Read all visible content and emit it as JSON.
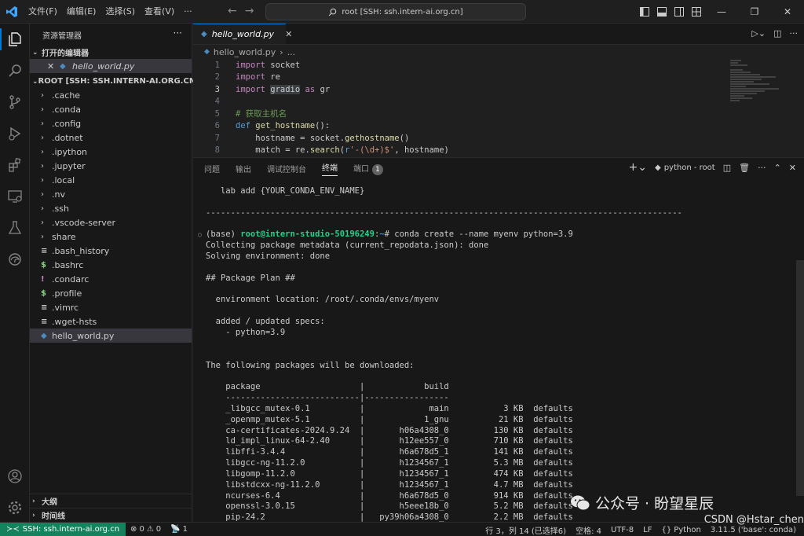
{
  "titlebar": {
    "menu": [
      "文件(F)",
      "编辑(E)",
      "选择(S)",
      "查看(V)",
      "···"
    ],
    "search_text": "root [SSH: ssh.intern-ai.org.cn]"
  },
  "sidebar": {
    "title": "资源管理器",
    "open_editors_label": "打开的编辑器",
    "open_editor_file": "hello_world.py",
    "root_label": "ROOT [SSH: SSH.INTERN-AI.ORG.CN]",
    "folders": [
      ".cache",
      ".conda",
      ".config",
      ".dotnet",
      ".ipython",
      ".jupyter",
      ".local",
      ".nv",
      ".ssh",
      ".vscode-server",
      "share"
    ],
    "files": [
      {
        "name": ".bash_history",
        "icon": "≡",
        "color": "#cccccc"
      },
      {
        "name": ".bashrc",
        "icon": "$",
        "color": "#89d185"
      },
      {
        "name": ".condarc",
        "icon": "!",
        "color": "#c586c0"
      },
      {
        "name": ".profile",
        "icon": "$",
        "color": "#89d185"
      },
      {
        "name": ".vimrc",
        "icon": "≡",
        "color": "#cccccc"
      },
      {
        "name": ".wget-hsts",
        "icon": "≡",
        "color": "#cccccc"
      },
      {
        "name": "hello_world.py",
        "icon": "py",
        "color": "#4b8bbe"
      }
    ],
    "outline_label": "大纲",
    "timeline_label": "时间线"
  },
  "editor": {
    "tab_label": "hello_world.py",
    "breadcrumb_file": "hello_world.py",
    "breadcrumb_more": "...",
    "lines": [
      {
        "n": "1",
        "html": "<span class='kw2'>import</span> socket"
      },
      {
        "n": "2",
        "html": "<span class='kw2'>import</span> re"
      },
      {
        "n": "3",
        "html": "<span class='kw2'>import</span> <span class='hl'>gradio</span> <span class='kw2'>as</span> gr"
      },
      {
        "n": "4",
        "html": ""
      },
      {
        "n": "5",
        "html": "<span class='cmt'># 获取主机名</span>"
      },
      {
        "n": "6",
        "html": "<span class='kw'>def</span> <span class='fn'>get_hostname</span>():"
      },
      {
        "n": "7",
        "html": "    hostname = socket.<span class='fn'>gethostname</span>()"
      },
      {
        "n": "8",
        "html": "    match = re.<span class='fn'>search</span>(<span class='kw'>r</span><span class='str'>'-(\\d+)$'</span>, hostname)"
      }
    ],
    "current_line": "3"
  },
  "panel": {
    "tabs": [
      "问题",
      "输出",
      "调试控制台",
      "终端",
      "端口"
    ],
    "active_tab": "终端",
    "ports_badge": "1",
    "terminal_name": "python - root",
    "prompt_user": "root@intern-studio-50196249",
    "prompt_path": "~",
    "command": "# conda create --name myenv python=3.9",
    "lines_before": [
      "   lab add {YOUR_CONDA_ENV_NAME}",
      "",
      "------------------------------------------------------------------------------------------------",
      ""
    ],
    "lines_after": [
      "Collecting package metadata (current_repodata.json): done",
      "Solving environment: done",
      "",
      "## Package Plan ##",
      "",
      "  environment location: /root/.conda/envs/myenv",
      "",
      "  added / updated specs:",
      "    - python=3.9",
      "",
      "",
      "The following packages will be downloaded:",
      "",
      "    package                    |            build",
      "    ---------------------------|-----------------",
      "    _libgcc_mutex-0.1          |             main           3 KB  defaults",
      "    _openmp_mutex-5.1          |            1_gnu          21 KB  defaults",
      "    ca-certificates-2024.9.24  |       h06a4308_0         130 KB  defaults",
      "    ld_impl_linux-64-2.40      |       h12ee557_0         710 KB  defaults",
      "    libffi-3.4.4               |       h6a678d5_1         141 KB  defaults",
      "    libgcc-ng-11.2.0           |       h1234567_1         5.3 MB  defaults",
      "    libgomp-11.2.0             |       h1234567_1         474 KB  defaults",
      "    libstdcxx-ng-11.2.0        |       h1234567_1         4.7 MB  defaults",
      "    ncurses-6.4                |       h6a678d5_0         914 KB  defaults",
      "    openssl-3.0.15             |       h5eee18b_0         5.2 MB  defaults",
      "    pip-24.2                   |   py39h06a4308_0         2.2 MB  defaults"
    ]
  },
  "statusbar": {
    "remote": "SSH: ssh.intern-ai.org.cn",
    "errors": "0",
    "warnings": "0",
    "ports": "1",
    "position": "行 3，列 14 (已选择6)",
    "spaces": "空格: 4",
    "encoding": "UTF-8",
    "eol": "LF",
    "language": "Python",
    "interpreter": "3.11.5 ('base': conda)"
  },
  "watermark": {
    "line1": "公众号 · 盼望星辰",
    "line2": "CSDN @Hstar_chen"
  },
  "colors": {
    "accent": "#0078d4",
    "remote": "#16825d",
    "prompt_user": "#23d18b",
    "prompt_path": "#3b8eea"
  }
}
